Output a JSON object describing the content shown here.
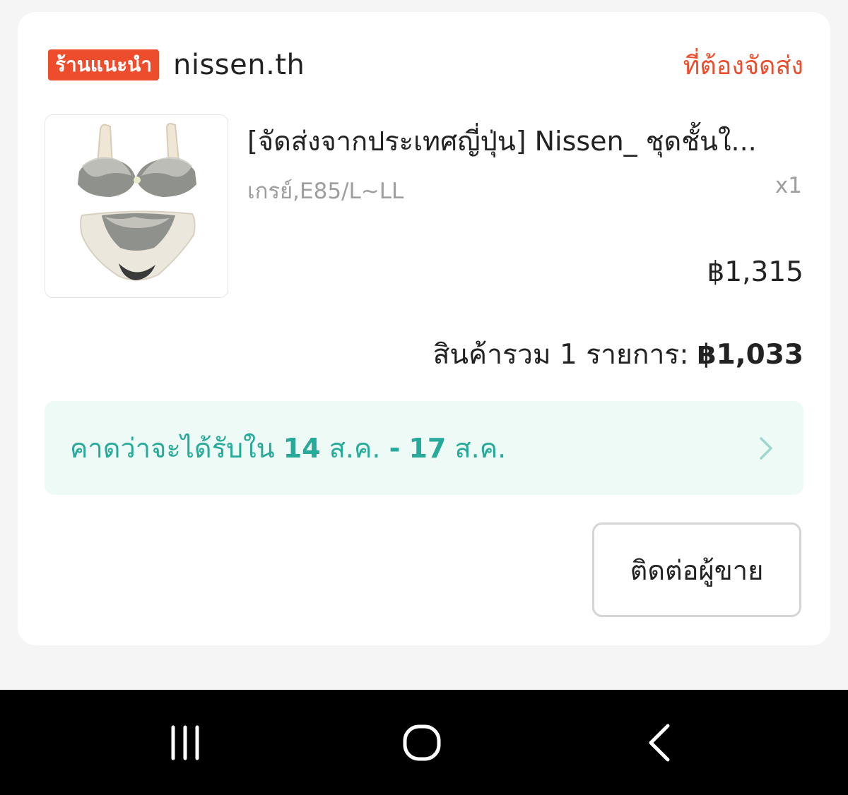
{
  "shop": {
    "badge": "ร้านแนะนำ",
    "name": "nissen.th",
    "status": "ที่ต้องจัดส่ง"
  },
  "product": {
    "image_icon": "lingerie-product-photo",
    "title": "[จัดส่งจากประเทศญี่ปุ่น] Nissen_  ชุดชั้นใ...",
    "variant": "เกรย์,E85/L~LL",
    "quantity": "x1",
    "price": "฿1,315"
  },
  "order_total": {
    "label": "สินค้ารวม 1 รายการ:",
    "amount": "฿1,033"
  },
  "delivery": {
    "prefix": "คาดว่าจะได้รับใน",
    "date_start": "14",
    "month_start": "ส.ค.",
    "separator": "-",
    "date_end": "17",
    "month_end": "ส.ค.",
    "icon": "chevron-right-icon"
  },
  "actions": {
    "contact_seller": "ติดต่อผู้ขาย"
  },
  "system_nav": {
    "recents_icon": "recents-icon",
    "home_icon": "home-icon",
    "back_icon": "back-icon"
  },
  "colors": {
    "brand_orange": "#ee4d2d",
    "delivery_teal": "#26aa99",
    "delivery_bg": "#eefaf6"
  }
}
